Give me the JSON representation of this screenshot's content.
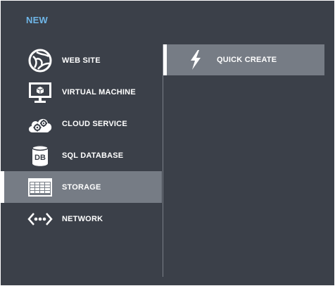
{
  "header": {
    "title": "NEW"
  },
  "menu": {
    "items": [
      {
        "label": "WEB SITE",
        "icon": "globe-icon"
      },
      {
        "label": "VIRTUAL MACHINE",
        "icon": "monitor-icon"
      },
      {
        "label": "CLOUD SERVICE",
        "icon": "cloud-gears-icon"
      },
      {
        "label": "SQL DATABASE",
        "icon": "database-icon"
      },
      {
        "label": "STORAGE",
        "icon": "storage-table-icon",
        "selected": true
      },
      {
        "label": "NETWORK",
        "icon": "network-icon"
      }
    ]
  },
  "submenu": {
    "items": [
      {
        "label": "QUICK CREATE",
        "icon": "lightning-bolt-icon",
        "selected": true
      }
    ]
  },
  "colors": {
    "background": "#3b4049",
    "selected": "#767c85",
    "accent": "#6fb6e8",
    "text": "#ffffff"
  }
}
